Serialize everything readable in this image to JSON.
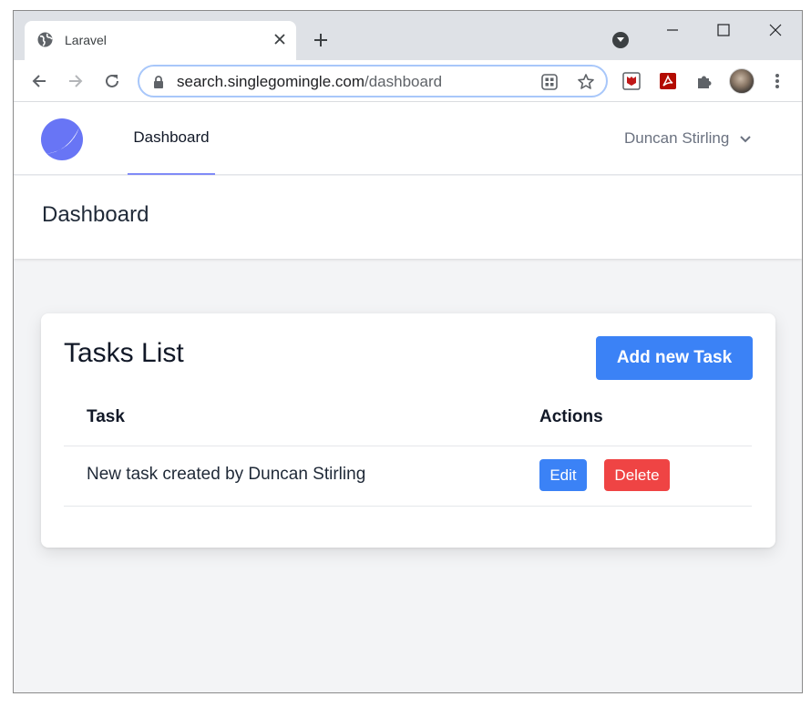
{
  "browser": {
    "tab_title": "Laravel",
    "url_host": "search.singlegomingle.com",
    "url_path": "/dashboard",
    "icons": [
      "globe-icon",
      "close-icon",
      "plus-icon",
      "tab-search-icon",
      "minimize-icon",
      "maximize-icon",
      "close-window-icon",
      "back-icon",
      "forward-icon",
      "reload-icon",
      "lock-icon",
      "qr-icon",
      "star-icon",
      "mcafee-icon",
      "pdf-icon",
      "extensions-icon",
      "profile-avatar",
      "menu-icon"
    ]
  },
  "app": {
    "nav_link": "Dashboard",
    "user_name": "Duncan Stirling",
    "page_title": "Dashboard",
    "accent_color": "#818cf8",
    "logo_color": "#6875f5"
  },
  "tasks": {
    "title": "Tasks List",
    "add_label": "Add new Task",
    "columns": [
      "Task",
      "Actions"
    ],
    "rows": [
      {
        "task": "New task created by Duncan Stirling",
        "edit_label": "Edit",
        "delete_label": "Delete"
      }
    ],
    "button_colors": {
      "primary": "#3b82f6",
      "danger": "#ef4444"
    }
  }
}
